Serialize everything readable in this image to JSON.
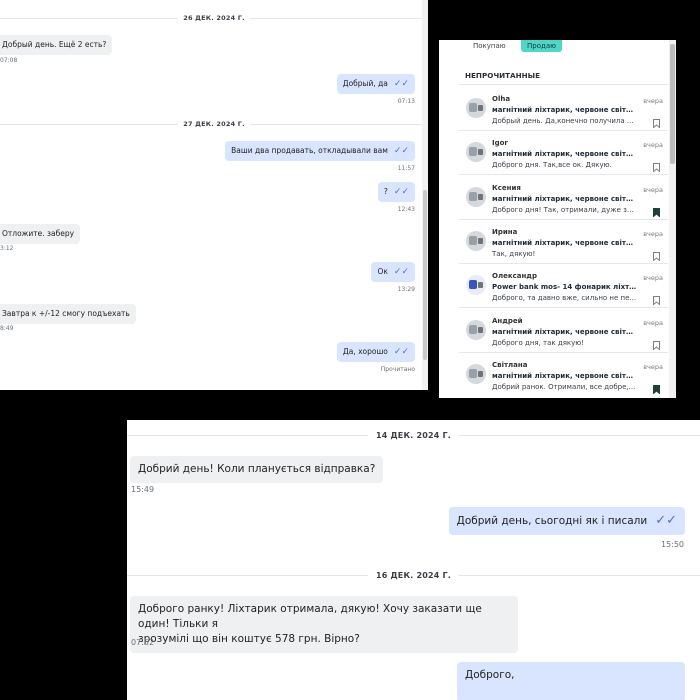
{
  "panel1": {
    "dates": [
      "26 ДЕК. 2024 Г.",
      "27 ДЕК. 2024 Г."
    ],
    "messages": [
      {
        "text": "Добрый день. Ещё 2 есть?",
        "time": "07:08"
      },
      {
        "text": "Добрый, да",
        "time": "07:13"
      },
      {
        "text": "Ваши два продавать, откладывали вам",
        "time": "11:57"
      },
      {
        "text": "?",
        "time": "12:43"
      },
      {
        "text": "Отложите.  заберу",
        "time": "3:12"
      },
      {
        "text": "Ок",
        "time": "13:29"
      },
      {
        "text": "Завтра к +/-12  смогу подъехать",
        "time": "8:49"
      },
      {
        "text": "Да, хорошо",
        "time": "Прочитано"
      }
    ]
  },
  "panel2": {
    "tabs": {
      "buy": "Покупаю",
      "sell": "Продаю"
    },
    "section_title": "НЕПРОЧИТАННЫЕ",
    "conversations": [
      {
        "name": "Olha",
        "title": "магнітний ліхтарик, червоне світло т...",
        "preview": "Добрый день. Да,конечно получила ...",
        "when": "вчера",
        "bookmarked": false
      },
      {
        "name": "Igor",
        "title": "магнітний ліхтарик, червоне світло т...",
        "preview": "Доброго дня. Так,все ок. Дякую.",
        "when": "вчера",
        "bookmarked": false
      },
      {
        "name": "Ксения",
        "title": "магнітний ліхтарик, червоне світло т...",
        "preview": "Доброго дня! Так, отримали, дуже за...",
        "when": "вчера",
        "bookmarked": true
      },
      {
        "name": "Ирина",
        "title": "магнітний ліхтарик, червоне світло т...",
        "preview": "Так, дякую!",
        "when": "вчера",
        "bookmarked": false
      },
      {
        "name": "Олександр",
        "title": "Power bank mos- 14 фонарик ліхтар ав...",
        "preview": "Доброго, та давно вже, сильно не пе...",
        "when": "вчера",
        "bookmarked": false
      },
      {
        "name": "Андрей",
        "title": "магнітний ліхтарик, червоне світло т...",
        "preview": "Доброго дня, так дякую!",
        "when": "вчера",
        "bookmarked": false
      },
      {
        "name": "Світлана",
        "title": "магнітний ліхтарик, червоне світло т...",
        "preview": "Добрий ранок. Отримали, все добре,...",
        "when": "вчера",
        "bookmarked": true
      }
    ]
  },
  "panel3": {
    "dates": [
      "14 ДЕК. 2024 Г.",
      "16 ДЕК. 2024 Г."
    ],
    "messages": [
      {
        "text": "Добрий день! Коли планується відправка?",
        "time": "15:49"
      },
      {
        "text": "Добрий день, сьогодні як і писали",
        "time": "15:50"
      },
      {
        "line1": "Доброго ранку! Ліхтарик отримала, дякую! Хочу заказати ще один! Тільки я",
        "line2": "зрозумілі що він коштує 578 грн. Вірно?",
        "time": "07:52"
      },
      {
        "text": "Доброго,"
      }
    ]
  },
  "icons": {
    "ticks": "double-check-icon",
    "bookmark": "bookmark-icon"
  },
  "colors": {
    "outgoing": "#d9e4ff",
    "incoming": "#eef0f2",
    "accent_tab": "#4fd6c7",
    "ticks": "#4f6fd0"
  }
}
